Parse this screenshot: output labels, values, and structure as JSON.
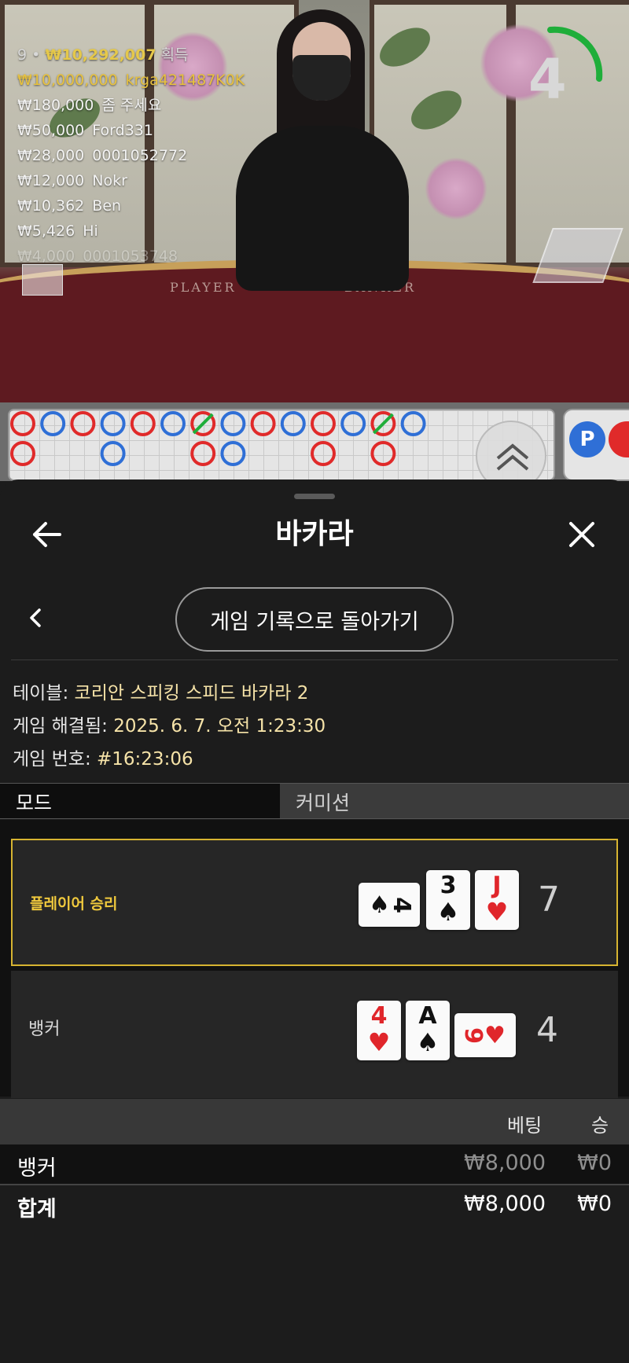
{
  "live": {
    "leaderboard_header": {
      "count": "9",
      "amount": "₩10,292,007",
      "suffix": "획득"
    },
    "leaderboard": [
      {
        "amount": "₩10,000,000",
        "name": "krga421487K0K"
      },
      {
        "amount": "₩180,000",
        "name": "좀 주세요"
      },
      {
        "amount": "₩50,000",
        "name": "Ford331"
      },
      {
        "amount": "₩28,000",
        "name": "0001052772"
      },
      {
        "amount": "₩12,000",
        "name": "Nokr"
      },
      {
        "amount": "₩10,362",
        "name": "Ben"
      },
      {
        "amount": "₩5,426",
        "name": "Hi"
      },
      {
        "amount": "₩4,000",
        "name": "0001053748"
      }
    ],
    "timer": "4",
    "felt_player": "PLAYER",
    "felt_banker": "BANKER"
  },
  "roads": {
    "bead_top_row": [
      "B",
      "P",
      "B",
      "P",
      "B",
      "P",
      "T",
      "P",
      "B",
      "P",
      "B",
      "P",
      "T",
      "P"
    ],
    "side_badge": "P"
  },
  "sheet": {
    "title": "바카라",
    "back_to_history": "게임 기록으로 돌아가기",
    "table_label": "테이블:",
    "table_value": "코리안 스피킹 스피드 바카라 2",
    "resolved_label": "게임 해결됨:",
    "resolved_value": "2025. 6. 7. 오전 1:23:30",
    "game_no_label": "게임 번호:",
    "game_no_value": "#16:23:06",
    "mode_label": "모드",
    "commission_label": "커미션",
    "player": {
      "label": "플레이어 승리",
      "score": "7",
      "cards": [
        {
          "rank": "4",
          "suit": "♠",
          "color": "#111111",
          "orientation": "sideways"
        },
        {
          "rank": "3",
          "suit": "♠",
          "color": "#111111",
          "orientation": "upright"
        },
        {
          "rank": "J",
          "suit": "♥",
          "color": "#e0262b",
          "orientation": "upright"
        }
      ]
    },
    "banker": {
      "label": "뱅커",
      "score": "4",
      "cards": [
        {
          "rank": "4",
          "suit": "♥",
          "color": "#e0262b",
          "orientation": "upright"
        },
        {
          "rank": "A",
          "suit": "♠",
          "color": "#111111",
          "orientation": "upright"
        },
        {
          "rank": "9",
          "suit": "♥",
          "color": "#e0262b",
          "orientation": "sideways"
        }
      ]
    },
    "bets": {
      "col_bet": "베팅",
      "col_win": "승",
      "rows": [
        {
          "name": "뱅커",
          "bet": "₩8,000",
          "win": "₩0"
        }
      ],
      "total": {
        "name": "합계",
        "bet": "₩8,000",
        "win": "₩0"
      }
    }
  },
  "colors": {
    "accent_gold": "#d7b431",
    "banker_red": "#e02a2a",
    "player_blue": "#2f6fd6"
  }
}
